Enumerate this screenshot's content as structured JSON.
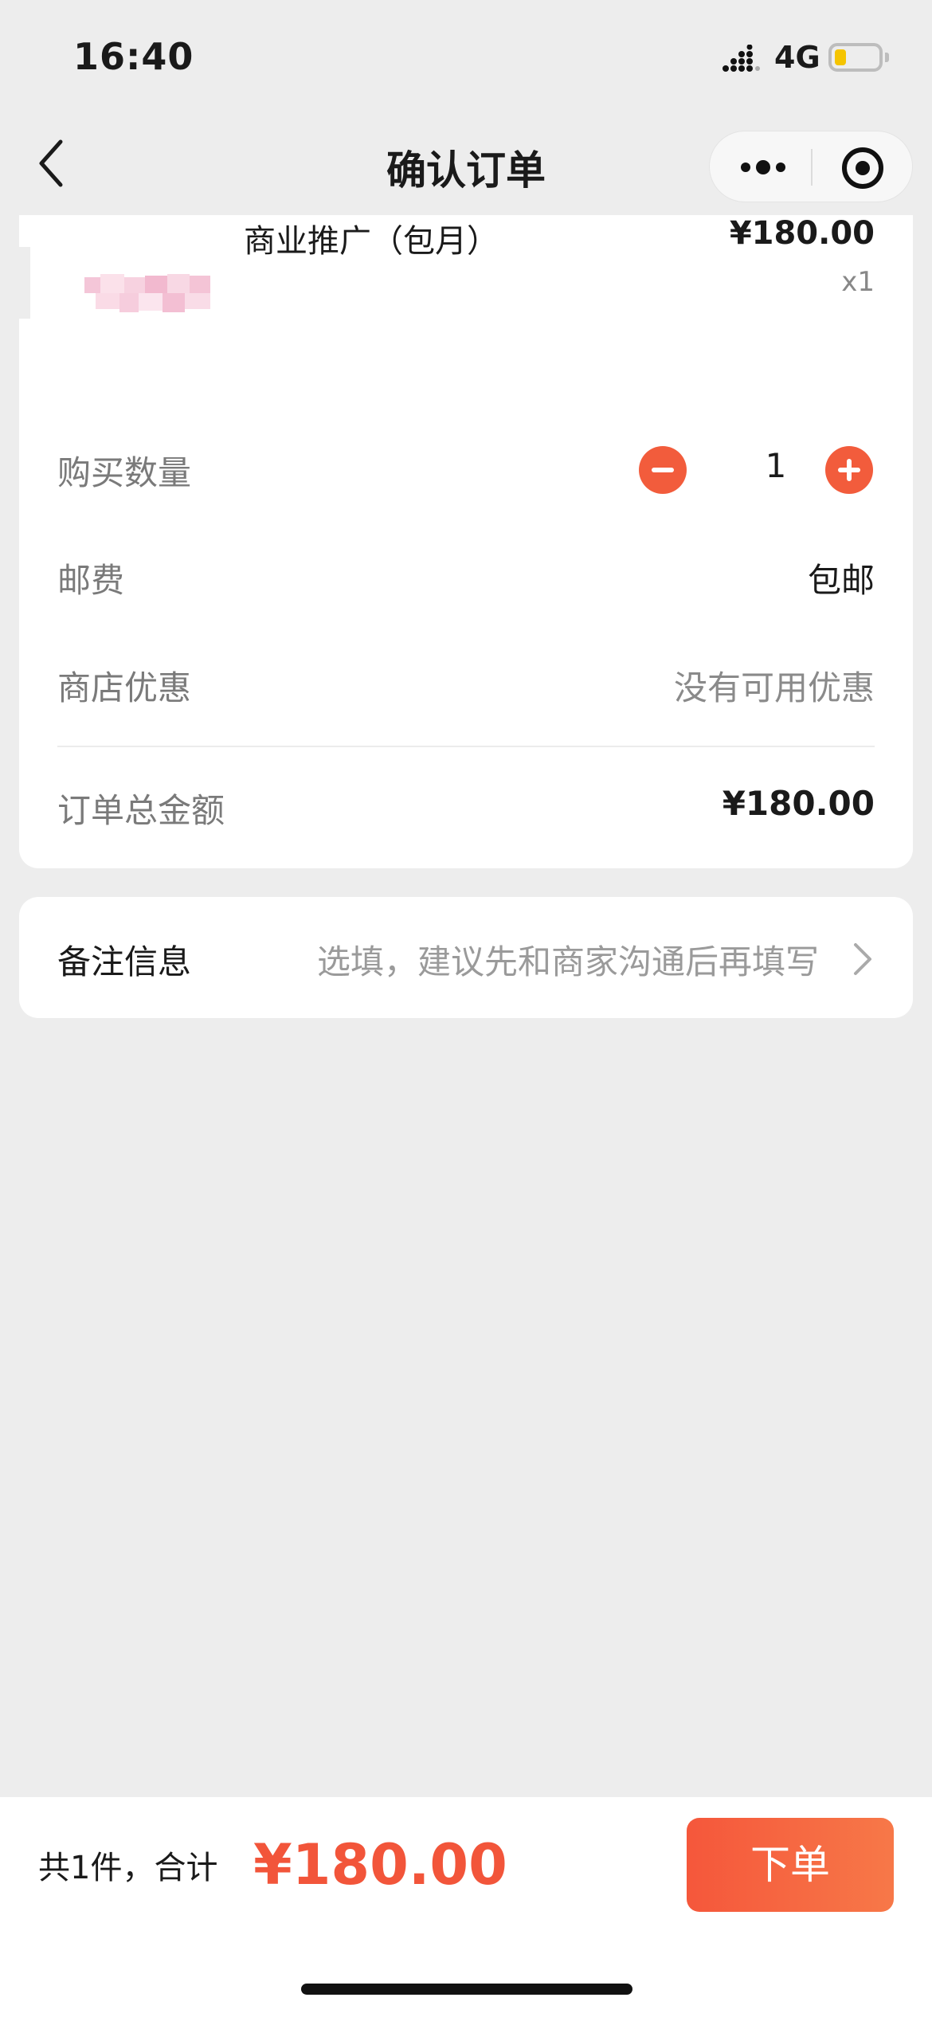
{
  "status_bar": {
    "time": "16:40",
    "network": "4G"
  },
  "nav": {
    "title": "确认订单"
  },
  "product": {
    "name": "商业推广（包月）",
    "price": "¥180.00",
    "quantity": "x1"
  },
  "rows": {
    "quantity_label": "购买数量",
    "quantity_value": "1",
    "shipping_label": "邮费",
    "shipping_value": "包邮",
    "discount_label": "商店优惠",
    "discount_value": "没有可用优惠",
    "total_label": "订单总金额",
    "total_value": "¥180.00"
  },
  "remark": {
    "label": "备注信息",
    "placeholder": "选填，建议先和商家沟通后再填写"
  },
  "footer": {
    "summary": "共1件，合计",
    "total": "¥180.00",
    "submit_label": "下单"
  },
  "colors": {
    "accent": "#f25c3c",
    "background": "#ededed"
  }
}
